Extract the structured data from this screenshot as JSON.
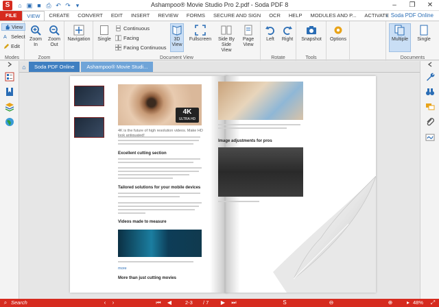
{
  "window": {
    "title": "Ashampoo® Movie Studio Pro 2.pdf - Soda PDF 8"
  },
  "tabs": {
    "file": "FILE",
    "items": [
      "VIEW",
      "CREATE",
      "CONVERT",
      "EDIT",
      "INSERT",
      "REVIEW",
      "FORMS",
      "SECURE AND SIGN",
      "OCR",
      "HELP",
      "MODULES AND P...",
      "ACTIVATE"
    ],
    "active": "VIEW",
    "brand": "Soda PDF Online"
  },
  "ribbon": {
    "modes": {
      "view": "View",
      "select": "Select",
      "edit": "Edit",
      "label": "Modes"
    },
    "zoom": {
      "zoom_in": "Zoom In",
      "zoom_out": "Zoom Out",
      "label": "Zoom"
    },
    "navigation": {
      "label": "Navigation"
    },
    "document_view": {
      "single": "Single",
      "continuous": "Continuous",
      "facing": "Facing",
      "facing_continuous": "Facing Continuous",
      "view_3d": "3D View",
      "fullscreen": "Fullscreen",
      "side_by_side": "Side By Side View",
      "page_view": "Page View",
      "label": "Document View"
    },
    "rotate": {
      "left": "Left",
      "right": "Right",
      "label": "Rotate"
    },
    "tools": {
      "snapshot": "Snapshot",
      "label": "Tools"
    },
    "options": {
      "label": "Options"
    },
    "documents": {
      "multiple": "Multiple",
      "single": "Single",
      "label": "Documents"
    }
  },
  "doc_tabs": [
    "Soda PDF Online",
    "Ashampoo® Movie Studi..."
  ],
  "page_content": {
    "fourk_big": "4K",
    "fourk_small": "ULTRA HD",
    "intro": "4K is the future of high resolution videos. Make HD look antiquated!",
    "head1": "Excellent cutting section",
    "head2": "Tailored solutions for your mobile devices",
    "head3": "Videos made to measure",
    "head4": "More than just cutting movies",
    "head_right": "Image adjustments for pros",
    "link": "more"
  },
  "status": {
    "search": "Search",
    "page": "2-3",
    "total": "/ 7",
    "zoom": "48%"
  },
  "colors": {
    "brand_red": "#d62b1f",
    "accent_blue": "#2a6db5",
    "check_green": "#2e9e3a"
  }
}
